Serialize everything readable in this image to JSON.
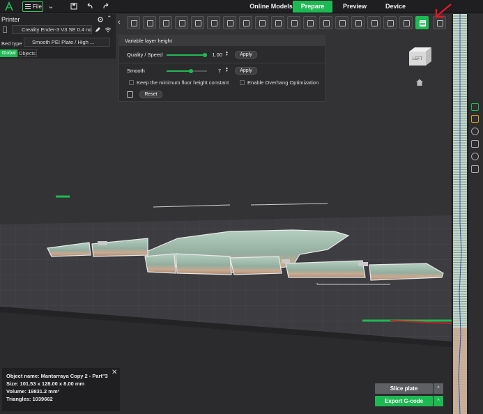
{
  "topbar": {
    "file_label": "File",
    "tabs": [
      {
        "label": "Online Models"
      },
      {
        "label": "Prepare",
        "active": true
      },
      {
        "label": "Preview"
      },
      {
        "label": "Device"
      }
    ]
  },
  "left_panel": {
    "printer_title": "Printer",
    "printer_name": "Creality Ender-3 V3 SE 0.4 no",
    "bed_type_label": "Bed type",
    "bed_type_value": "Smooth PEI Plate / High ...",
    "seg_global": "Global",
    "seg_objects": "Objects"
  },
  "vlh_panel": {
    "title": "Variable layer height",
    "quality_label": "Quality / Speed",
    "quality_value": "1.00",
    "quality_fraction": 0.98,
    "smooth_label": "Smooth",
    "smooth_value": "7",
    "smooth_fraction": 0.6,
    "apply_label": "Apply",
    "keep_floor_label": "Keep the minimum floor height constant",
    "overhang_label": "Enable Overhang Optimization",
    "reset_label": "Reset"
  },
  "viewcube": {
    "face_label": "LEFT"
  },
  "object_info": {
    "name_line": "Object name: Mantarraya Copy 2 - Part\"3",
    "size_line": "Size: 101.53 x 128.00 x 8.00 mm",
    "volume_line": "Volume: 19831.2 mm³",
    "triangles_line": "Triangles: 1039662",
    "close": "✕"
  },
  "bottom_buttons": {
    "slice_label": "Slice plate",
    "export_label": "Export G-code",
    "arrow": "^"
  },
  "icons": {
    "logo": "creality-logo-icon",
    "save": "save-icon",
    "undo": "undo-icon",
    "redo": "redo-icon",
    "settings": "gear-icon",
    "collapse": "chevrons-up-icon",
    "edit": "pencil-icon",
    "wifi": "wifi-icon",
    "home": "home-icon",
    "chevron_left": "‹"
  },
  "colors": {
    "accent": "#1fb954",
    "model": "#a8c4b4",
    "arrow_annotation": "#e0192a"
  }
}
